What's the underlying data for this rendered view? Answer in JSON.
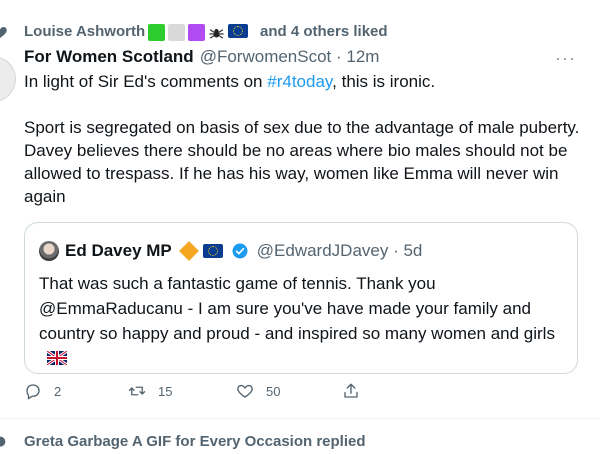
{
  "social_context": {
    "liker_name": "Louise Ashworth",
    "emoji_colors": [
      "#2ecc2e",
      "#d9d9d9",
      "#b24cf2"
    ],
    "emoji_icons": [
      "spider-icon",
      "eu-flag-icon"
    ],
    "liked_suffix": "and 4 others liked"
  },
  "tweet": {
    "author_name": "For Women Scotland",
    "meta": "@ForwomenScot · 12m",
    "text_line1_prefix": "In light of Sir Ed's comments on ",
    "hashtag": "#r4today",
    "text_line1_suffix": ", this is ironic.",
    "text_para2": "Sport is segregated on basis of sex due to the advantage of male puberty. Davey believes there should be no areas where bio males should not be allowed to trespass. If he has his way, women like Emma will never win again",
    "more_icon": "···"
  },
  "quote": {
    "name": "Ed Davey MP",
    "handle": "@EdwardJDavey · 5d",
    "text": "That was such a fantastic game of tennis. Thank you @EmmaRaducanu - I am sure you've have made your family and country so happy and proud - and inspired so many women and girls"
  },
  "actions": {
    "reply_count": "2",
    "retweet_count": "15",
    "like_count": "50"
  },
  "next_context": {
    "text": "Greta Garbage A GIF for Every Occasion replied"
  }
}
